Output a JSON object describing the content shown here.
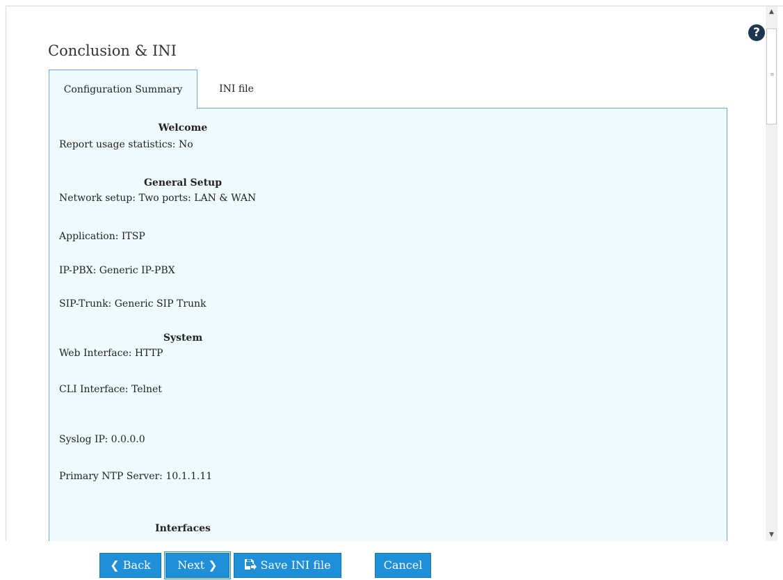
{
  "header": {
    "title": "Conclusion & INI",
    "help_icon": "?"
  },
  "tabs": [
    {
      "label": "Configuration Summary",
      "active": true
    },
    {
      "label": "INI file",
      "active": false
    }
  ],
  "summary": {
    "welcome_heading": "Welcome",
    "report_usage": "Report usage statistics: No",
    "general_heading": "General Setup",
    "network_setup": "Network setup: Two ports: LAN & WAN",
    "application": "Application: ITSP",
    "ip_pbx": "IP-PBX: Generic IP-PBX",
    "sip_trunk": "SIP-Trunk: Generic SIP Trunk",
    "system_heading": "System",
    "web_interface": "Web Interface: HTTP",
    "cli_interface": "CLI Interface: Telnet",
    "syslog_ip": "Syslog IP: 0.0.0.0",
    "ntp_server": "Primary NTP Server: 10.1.1.11",
    "interfaces_heading": "Interfaces"
  },
  "footer": {
    "back_label": "Back",
    "back_icon": "chevron-left-icon",
    "next_label": "Next",
    "next_icon": "chevron-right-icon",
    "save_label": "Save INI file",
    "save_icon": "save-file-icon",
    "cancel_label": "Cancel"
  },
  "colors": {
    "accent": "#1f8fd8",
    "panel_bg": "#effafd",
    "panel_border": "#6fa8dc",
    "help_icon_bg": "#1f3550"
  }
}
